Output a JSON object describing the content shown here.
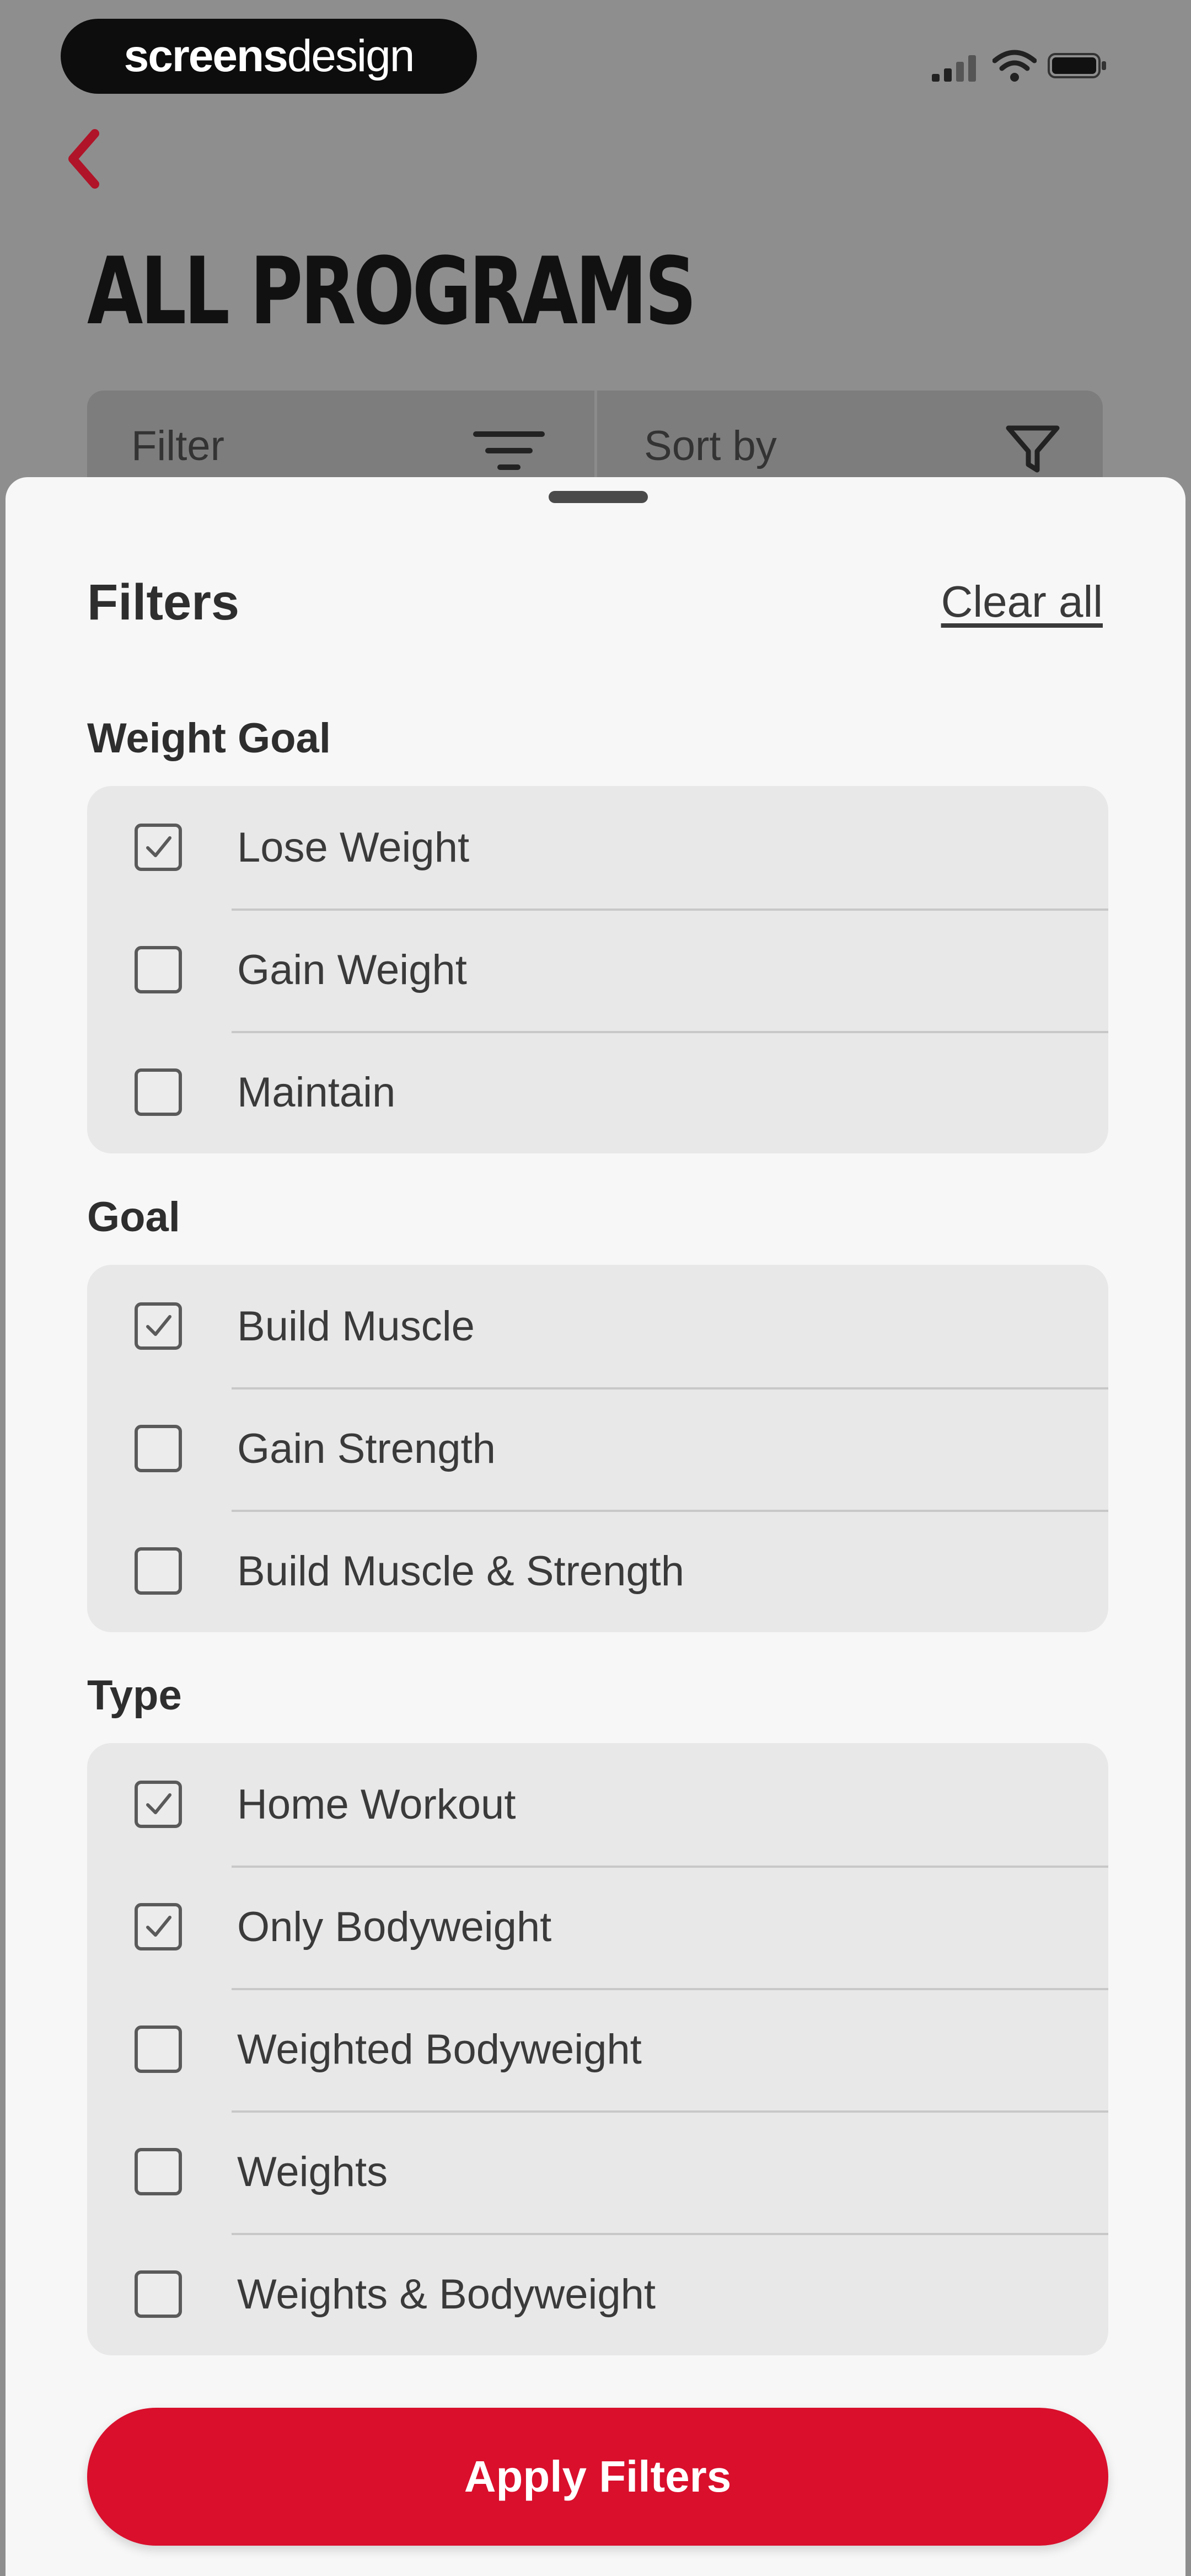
{
  "status_bar": {
    "brand_part1": "screens",
    "brand_part2": "design",
    "icons": [
      "cellular-signal-icon",
      "wifi-icon",
      "battery-icon"
    ]
  },
  "nav": {
    "back_icon": "chevron-left-icon"
  },
  "page": {
    "title": "ALL PROGRAMS"
  },
  "toolbar": {
    "filter_label": "Filter",
    "filter_icon": "filter-lines-icon",
    "sort_label": "Sort by",
    "sort_icon": "funnel-icon"
  },
  "sheet": {
    "title": "Filters",
    "clear_all": "Clear all",
    "sections": [
      {
        "title": "Weight Goal",
        "options": [
          {
            "label": "Lose Weight",
            "checked": true
          },
          {
            "label": "Gain Weight",
            "checked": false
          },
          {
            "label": "Maintain",
            "checked": false
          }
        ]
      },
      {
        "title": "Goal",
        "options": [
          {
            "label": "Build Muscle",
            "checked": true
          },
          {
            "label": "Gain Strength",
            "checked": false
          },
          {
            "label": "Build Muscle & Strength",
            "checked": false
          }
        ]
      },
      {
        "title": "Type",
        "options": [
          {
            "label": "Home Workout",
            "checked": true
          },
          {
            "label": "Only Bodyweight",
            "checked": true
          },
          {
            "label": "Weighted Bodyweight",
            "checked": false
          },
          {
            "label": "Weights",
            "checked": false
          },
          {
            "label": "Weights & Bodyweight",
            "checked": false
          }
        ]
      }
    ],
    "apply_label": "Apply Filters"
  },
  "colors": {
    "accent": "#d90f2c",
    "overlay": "#8e8e8e",
    "sheet_bg": "#f7f7f7",
    "group_bg": "#e8e8e8"
  }
}
